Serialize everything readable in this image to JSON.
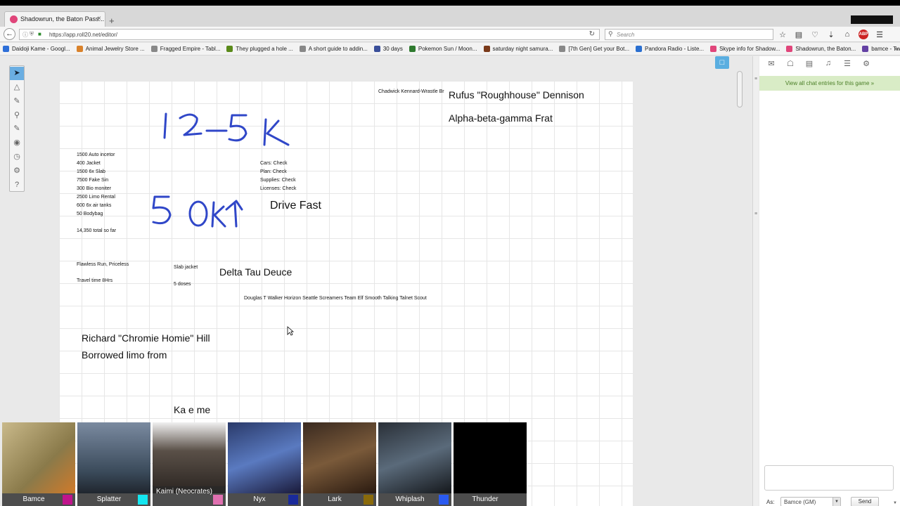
{
  "browser": {
    "tab_title": "Shadowrun, the Baton Pass...",
    "tab_close": "×",
    "new_tab": "+",
    "url": "https://app.roll20.net/editor/",
    "search_placeholder": "Search",
    "bookmarks": [
      {
        "label": "Daidoji Kame - Googl...",
        "color": "#2e6fd8"
      },
      {
        "label": "Animal Jewelry Store ...",
        "color": "#d9822b"
      },
      {
        "label": "Fragged Empire - Tabl...",
        "color": "#888888"
      },
      {
        "label": "They plugged a hole ...",
        "color": "#5a8a1a"
      },
      {
        "label": "A short guide to addin...",
        "color": "#888888"
      },
      {
        "label": "30 days",
        "color": "#3a4f9a"
      },
      {
        "label": "Pokemon Sun / Moon...",
        "color": "#2f7a2f"
      },
      {
        "label": "saturday night samura...",
        "color": "#7a3a1a"
      },
      {
        "label": "[7th Gen] Get your Bot...",
        "color": "#888888"
      },
      {
        "label": "Pandora Radio - Liste...",
        "color": "#2a6fd0"
      },
      {
        "label": "Skype info for Shadow...",
        "color": "#e0457a"
      },
      {
        "label": "Shadowrun, the Baton...",
        "color": "#e0457a"
      },
      {
        "label": "bamce - Twitch",
        "color": "#6441a4"
      }
    ]
  },
  "canvas": {
    "gm_text_small": "Chadwick Kennard-Wrastle Br",
    "rufus": "Rufus \"Roughhouse\" Dennison",
    "frat": "Alpha-beta-gamma Frat",
    "expenses": [
      "1500 Auto incetor",
      "400 Jacket",
      "1500 6x Slab",
      "7500 Fake Sin",
      "300 Bio moniter",
      "2500 Limo Rental",
      "600  6x air tanks",
      "50 Bodybag"
    ],
    "total": "14,350 total so far",
    "checks": [
      "Cars: Check",
      "Plan: Check",
      "Supplies: Check",
      "Licenses: Check"
    ],
    "drive_fast": "Drive Fast",
    "flawless": "Flawless Run, Priceless",
    "travel": "Travel time 8Hrs",
    "slab_jacket": "Slab jacket",
    "doses": "5 doses",
    "delta": "Delta Tau Deuce",
    "douglas": "Douglas  T Walker Horizon Seattle Screamers Team  Elf Smooth Talking Talnet Scout",
    "richard": "Richard \"Chromie Homie\" Hill",
    "borrowed": "Borrowed limo from",
    "kaeme": "Ka e me"
  },
  "players": [
    {
      "name": "Bamce",
      "swatch": "#c0148c"
    },
    {
      "name": "Splatter",
      "swatch": "#14e6f0"
    },
    {
      "name": "Kaimi (Neocrates)",
      "swatch": "#e070b0"
    },
    {
      "name": "Nyx",
      "swatch": "#1a2a9a"
    },
    {
      "name": "Lark",
      "swatch": "#8a6a0a"
    },
    {
      "name": "Whiplash",
      "swatch": "#2a5af0"
    },
    {
      "name": "Thunder",
      "swatch": ""
    }
  ],
  "chat": {
    "banner": "View all chat entries for this game »",
    "as_label": "As:",
    "speaking_as": "Bamce (GM)",
    "send_label": "Send"
  }
}
